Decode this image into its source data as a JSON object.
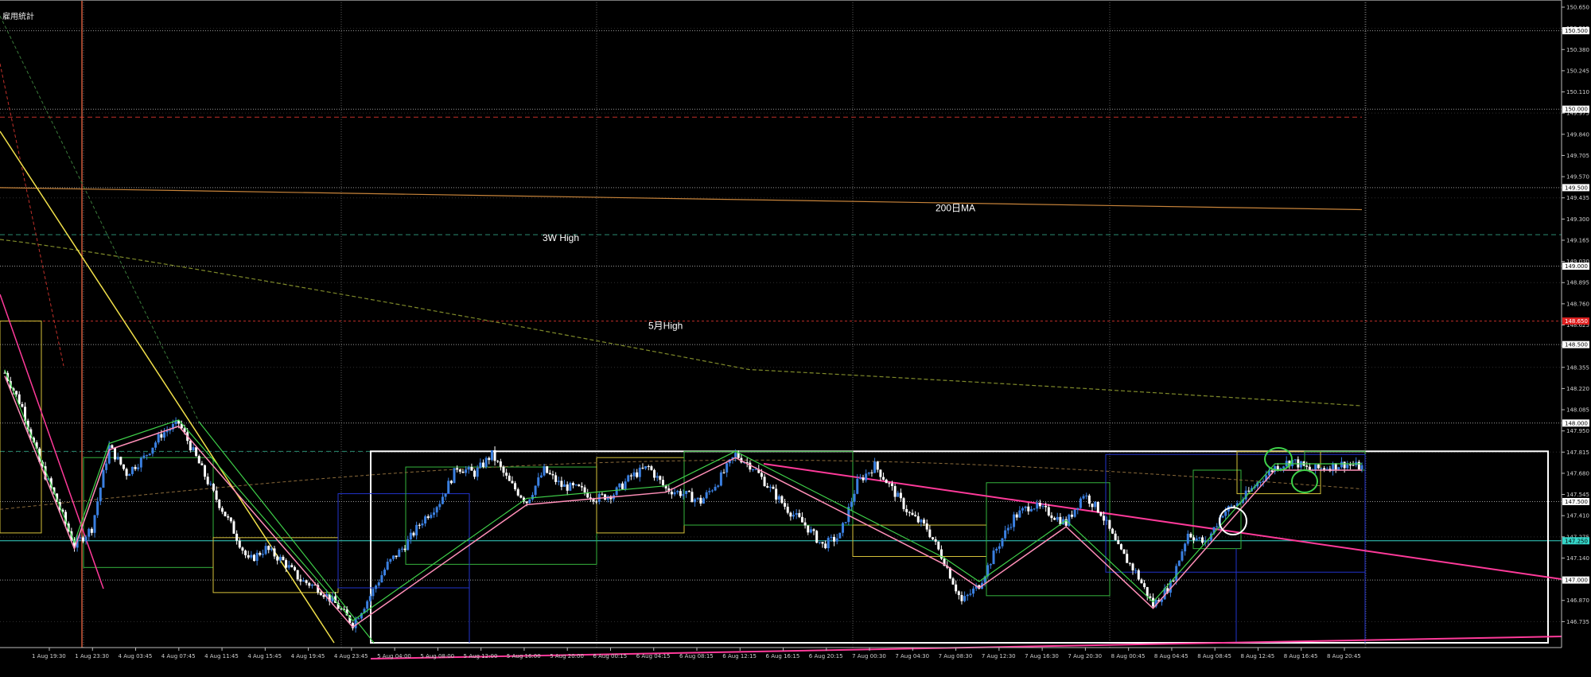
{
  "chart_data": {
    "type": "candlestick",
    "title": "雇用統計",
    "colors": {
      "background": "#000000",
      "bull": "#3a7fe0",
      "bear": "#ffffff",
      "grid": "#5a5a5a",
      "zigzag_pink": "#ff8fb8",
      "zigzag_green": "#3fd14a",
      "trend_pink": "#ff3a9a",
      "trend_yellow": "#f2e14a",
      "box_white": "#ffffff",
      "box_yellow": "#d6c23a",
      "box_green": "#35b43d",
      "box_blue": "#2233cc",
      "ma_orange": "#c8843a",
      "ma_olive": "#7f8a2a",
      "line_cyan": "#35d6c9",
      "line_red_dash": "#c0302a",
      "line_teal_dash": "#2a8a70",
      "vline_orange": "#d05a3a",
      "circle_green": "#3fd14a",
      "circle_white": "#ffffff"
    },
    "y_axis": {
      "range": [
        146.6,
        150.65
      ],
      "ticks": [
        "150.650",
        "150.515",
        "150.380",
        "150.245",
        "150.110",
        "149.975",
        "149.840",
        "149.705",
        "149.570",
        "149.435",
        "149.300",
        "149.165",
        "149.030",
        "148.895",
        "148.760",
        "148.625",
        "148.490",
        "148.355",
        "148.220",
        "148.085",
        "147.950",
        "147.815",
        "147.680",
        "147.545",
        "147.410",
        "147.275",
        "147.140",
        "147.005",
        "146.870",
        "146.735"
      ],
      "ticks_values": [
        150.65,
        150.515,
        150.38,
        150.245,
        150.11,
        149.975,
        149.84,
        149.705,
        149.57,
        149.435,
        149.3,
        149.165,
        149.03,
        148.895,
        148.76,
        148.625,
        148.49,
        148.355,
        148.22,
        148.085,
        147.95,
        147.815,
        147.68,
        147.545,
        147.41,
        147.275,
        147.14,
        147.005,
        146.87,
        146.735
      ],
      "price_tags": [
        {
          "value": 150.5,
          "label": "150.500",
          "color": "#e0e0e0"
        },
        {
          "value": 150.0,
          "label": "150.000",
          "color": "#e0e0e0"
        },
        {
          "value": 149.5,
          "label": "149.500",
          "color": "#e0e0e0"
        },
        {
          "value": 149.0,
          "label": "149.000",
          "color": "#e0e0e0"
        },
        {
          "value": 148.65,
          "label": "148.650",
          "color": "#e02020"
        },
        {
          "value": 148.5,
          "label": "148.500",
          "color": "#e0e0e0"
        },
        {
          "value": 148.0,
          "label": "148.000",
          "color": "#e0e0e0"
        },
        {
          "value": 147.5,
          "label": "147.500",
          "color": "#e0e0e0"
        },
        {
          "value": 147.25,
          "label": "147.250",
          "color": "#35d6c9"
        },
        {
          "value": 147.0,
          "label": "147.000",
          "color": "#e0e0e0"
        }
      ]
    },
    "x_axis": {
      "labels": [
        "1 Aug 19:30",
        "1 Aug 23:30",
        "4 Aug 03:45",
        "4 Aug 07:45",
        "4 Aug 11:45",
        "4 Aug 15:45",
        "4 Aug 19:45",
        "4 Aug 23:45",
        "5 Aug 04:00",
        "5 Aug 08:00",
        "5 Aug 12:00",
        "5 Aug 16:00",
        "5 Aug 20:00",
        "6 Aug 00:15",
        "6 Aug 04:15",
        "6 Aug 08:15",
        "6 Aug 12:15",
        "6 Aug 16:15",
        "6 Aug 20:15",
        "7 Aug 00:30",
        "7 Aug 04:30",
        "7 Aug 08:30",
        "7 Aug 12:30",
        "7 Aug 16:30",
        "7 Aug 20:30",
        "8 Aug 00:45",
        "8 Aug 04:45",
        "8 Aug 08:45",
        "8 Aug 12:45",
        "8 Aug 16:45",
        "8 Aug 20:45"
      ]
    },
    "annotations": [
      {
        "text": "200日MA",
        "x_label": "8 Aug 08:45",
        "y": 149.37
      },
      {
        "text": "3W High",
        "x_label": "5 Aug 16:00",
        "y": 149.18
      },
      {
        "text": "5月High",
        "x_label": "6 Aug 00:15",
        "y": 148.62
      }
    ],
    "series": [
      {
        "name": "Price (close path)",
        "values": [
          148.32,
          148.1,
          147.75,
          147.5,
          147.22,
          147.33,
          147.85,
          147.68,
          147.78,
          147.93,
          148.0,
          147.78,
          147.55,
          147.35,
          147.12,
          147.2,
          147.12,
          147.0,
          146.95,
          146.85,
          146.72,
          146.9,
          147.1,
          147.22,
          147.38,
          147.5,
          147.72,
          147.68,
          147.8,
          147.62,
          147.5,
          147.7,
          147.6,
          147.58,
          147.52,
          147.55,
          147.66,
          147.72,
          147.58,
          147.55,
          147.5,
          147.63,
          147.8,
          147.72,
          147.58,
          147.45,
          147.35,
          147.22,
          147.28,
          147.62,
          147.73,
          147.58,
          147.42,
          147.33,
          147.12,
          146.86,
          146.97,
          147.2,
          147.4,
          147.48,
          147.43,
          147.36,
          147.55,
          147.43,
          147.2,
          147.05,
          146.84,
          146.97,
          147.3,
          147.23,
          147.43,
          147.5,
          147.62,
          147.72,
          147.76,
          147.7,
          147.72,
          147.74,
          147.72
        ]
      }
    ]
  }
}
